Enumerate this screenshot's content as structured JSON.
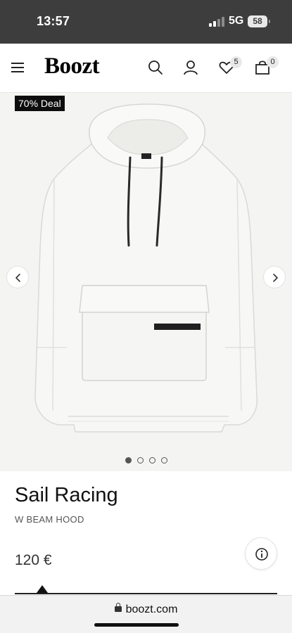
{
  "status_bar": {
    "time": "13:57",
    "network": "5G",
    "battery": "58"
  },
  "header": {
    "logo": "Boozt",
    "wishlist_count": "5",
    "cart_count": "0",
    "icons": [
      "menu-icon",
      "search-icon",
      "account-icon",
      "heart-icon",
      "bag-icon"
    ]
  },
  "gallery": {
    "deal_label": "70% Deal",
    "image_subject": "white hoodie",
    "slide_count": 4,
    "active_slide": 1
  },
  "product": {
    "brand": "Sail Racing",
    "name": "W BEAM HOOD",
    "price": "120 €"
  },
  "browser": {
    "url": "boozt.com"
  }
}
